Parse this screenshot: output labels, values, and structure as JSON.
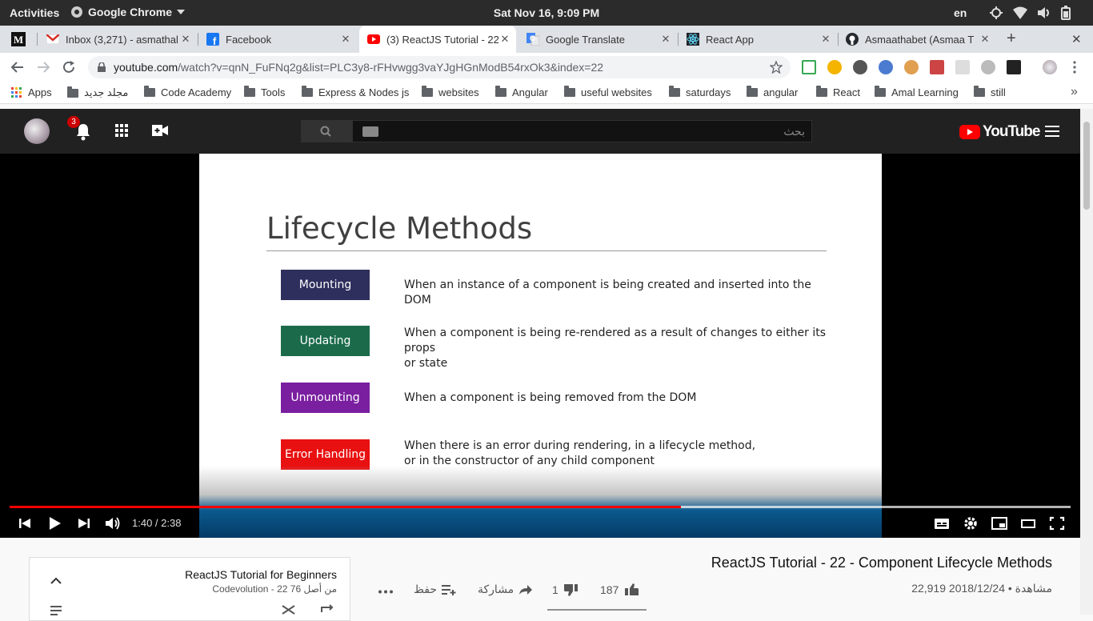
{
  "system_bar": {
    "activities": "Activities",
    "app_name": "Google Chrome",
    "clock": "Sat Nov 16,  9:09 PM",
    "language": "en"
  },
  "tabs": [
    {
      "label": "Inbox (3,271) - asmathal",
      "icon": "gmail-icon",
      "close": "✕"
    },
    {
      "label": "Facebook",
      "icon": "facebook-icon",
      "close": "✕"
    },
    {
      "label": "(3) ReactJS Tutorial - 22",
      "icon": "youtube-icon",
      "close": "✕",
      "active": true
    },
    {
      "label": "Google Translate",
      "icon": "google-translate-icon",
      "close": "✕"
    },
    {
      "label": "React App",
      "icon": "react-icon",
      "close": "✕"
    },
    {
      "label": "Asmaathabet (Asmaa T",
      "icon": "github-icon",
      "close": "✕"
    }
  ],
  "new_tab": "+",
  "window_close": "✕",
  "omnibox": {
    "domain": "youtube.com",
    "path": "/watch?v=qnN_FuFNq2g&list=PLC3y8-rFHvwgg3vaYJgHGnModB54rxOk3&index=22"
  },
  "bookmarks": [
    {
      "label": "Apps",
      "type": "apps"
    },
    {
      "label": "مجلد جديد",
      "type": "folder"
    },
    {
      "label": "Code Academy",
      "type": "folder"
    },
    {
      "label": "Tools",
      "type": "folder"
    },
    {
      "label": "Express & Nodes js",
      "type": "folder"
    },
    {
      "label": "websites",
      "type": "folder"
    },
    {
      "label": "Angular",
      "type": "folder"
    },
    {
      "label": "useful websites",
      "type": "folder"
    },
    {
      "label": "saturdays",
      "type": "folder"
    },
    {
      "label": "angular",
      "type": "folder"
    },
    {
      "label": "React",
      "type": "folder"
    },
    {
      "label": "Amal Learning",
      "type": "folder"
    },
    {
      "label": "still",
      "type": "folder"
    }
  ],
  "bookmarks_overflow": "»",
  "youtube": {
    "notification_count": "3",
    "search_placeholder": "بحث",
    "logo_text": "YouTube"
  },
  "slide": {
    "title": "Lifecycle Methods",
    "phases": [
      {
        "label": "Mounting",
        "color": "#2f2f5e",
        "desc_lines": [
          "When an instance of a component is being created and inserted into the DOM"
        ]
      },
      {
        "label": "Updating",
        "color": "#1b6b4b",
        "desc_lines": [
          "When a component is being re-rendered as a result of changes to either its props",
          "or state"
        ]
      },
      {
        "label": "Unmounting",
        "color": "#7a1fa0",
        "desc_lines": [
          "When a component is being removed from the DOM"
        ]
      },
      {
        "label": "Error Handling",
        "color": "#e81010",
        "desc_lines": [
          "When there is an error during rendering, in a lifecycle method,",
          "or in the constructor of any child component"
        ]
      }
    ]
  },
  "player": {
    "time": "1:40 / 2:38",
    "played_fraction": 0.633,
    "buffered_fraction": 1.0
  },
  "playlist": {
    "title": "ReactJS Tutorial for Beginners",
    "subtitle": "Codevolution - 22 من أصل 76"
  },
  "video": {
    "title": "ReactJS Tutorial - 22 - Component Lifecycle Methods",
    "views_date": "22,919 مشاهدة • 2018/12/24",
    "save_label": "حفظ",
    "share_label": "مشاركة",
    "dislikes": "1",
    "likes": "187"
  }
}
